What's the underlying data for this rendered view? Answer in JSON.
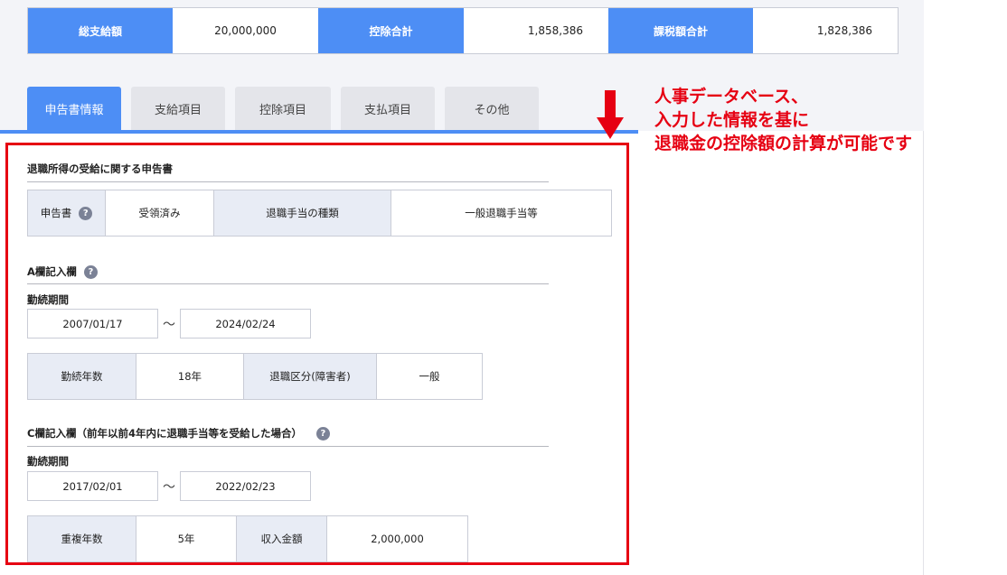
{
  "summary": {
    "total_pay_label": "総支給額",
    "total_pay_value": "20,000,000",
    "deduction_label": "控除合計",
    "deduction_value": "1,858,386",
    "taxable_label": "課税額合計",
    "taxable_value": "1,828,386"
  },
  "tabs": [
    {
      "label": "申告書情報"
    },
    {
      "label": "支給項目"
    },
    {
      "label": "控除項目"
    },
    {
      "label": "支払項目"
    },
    {
      "label": "その他"
    }
  ],
  "callout": {
    "line1": "人事データベース、",
    "line2": "入力した情報を基に",
    "line3": "退職金の控除額の計算が可能です"
  },
  "section_declaration": {
    "title": "退職所得の受給に関する申告書",
    "form_label": "申告書",
    "form_value": "受領済み",
    "type_label": "退職手当の種類",
    "type_value": "一般退職手当等"
  },
  "help_glyph": "?",
  "section_a": {
    "title": "A欄記入欄",
    "period_label": "勤続期間",
    "start": "2007/01/17",
    "end": "2024/02/24",
    "tilde": "〜",
    "years_label": "勤続年数",
    "years_value": "18年",
    "category_label": "退職区分(障害者)",
    "category_value": "一般"
  },
  "section_c": {
    "title": "C欄記入欄（前年以前4年内に退職手当等を受給した場合）",
    "period_label": "勤続期間",
    "start": "2017/02/01",
    "end": "2022/02/23",
    "tilde": "〜",
    "overlap_label": "重複年数",
    "overlap_value": "5年",
    "income_label": "収入金額",
    "income_value": "2,000,000"
  },
  "colors": {
    "accent": "#4d8ef5",
    "highlight": "#e60012"
  }
}
